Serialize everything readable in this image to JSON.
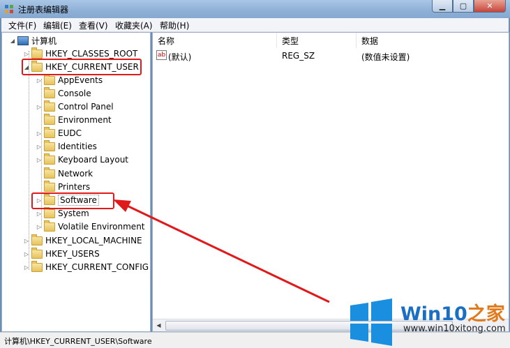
{
  "window": {
    "title": "注册表编辑器",
    "min_label": "▁",
    "max_label": "▢",
    "close_label": "✕"
  },
  "menu": [
    "文件(F)",
    "编辑(E)",
    "查看(V)",
    "收藏夹(A)",
    "帮助(H)"
  ],
  "tree": {
    "root": "计算机",
    "hives": {
      "classes_root": "HKEY_CLASSES_ROOT",
      "current_user": "HKEY_CURRENT_USER",
      "local_machine": "HKEY_LOCAL_MACHINE",
      "users": "HKEY_USERS",
      "current_config": "HKEY_CURRENT_CONFIG"
    },
    "current_user_children": [
      "AppEvents",
      "Console",
      "Control Panel",
      "Environment",
      "EUDC",
      "Identities",
      "Keyboard Layout",
      "Network",
      "Printers",
      "Software",
      "System",
      "Volatile Environment"
    ]
  },
  "list": {
    "headers": [
      "名称",
      "类型",
      "数据"
    ],
    "rows": [
      {
        "name": "(默认)",
        "type": "REG_SZ",
        "data": "(数值未设置)",
        "icon": "ab"
      }
    ]
  },
  "status": "计算机\\HKEY_CURRENT_USER\\Software",
  "watermark": {
    "brand": "Win10",
    "suffix": "之家",
    "site": "www.win10xitong.com"
  },
  "accent": {
    "annotation_red": "#e0191a",
    "brand_blue": "#1a6fc4"
  }
}
